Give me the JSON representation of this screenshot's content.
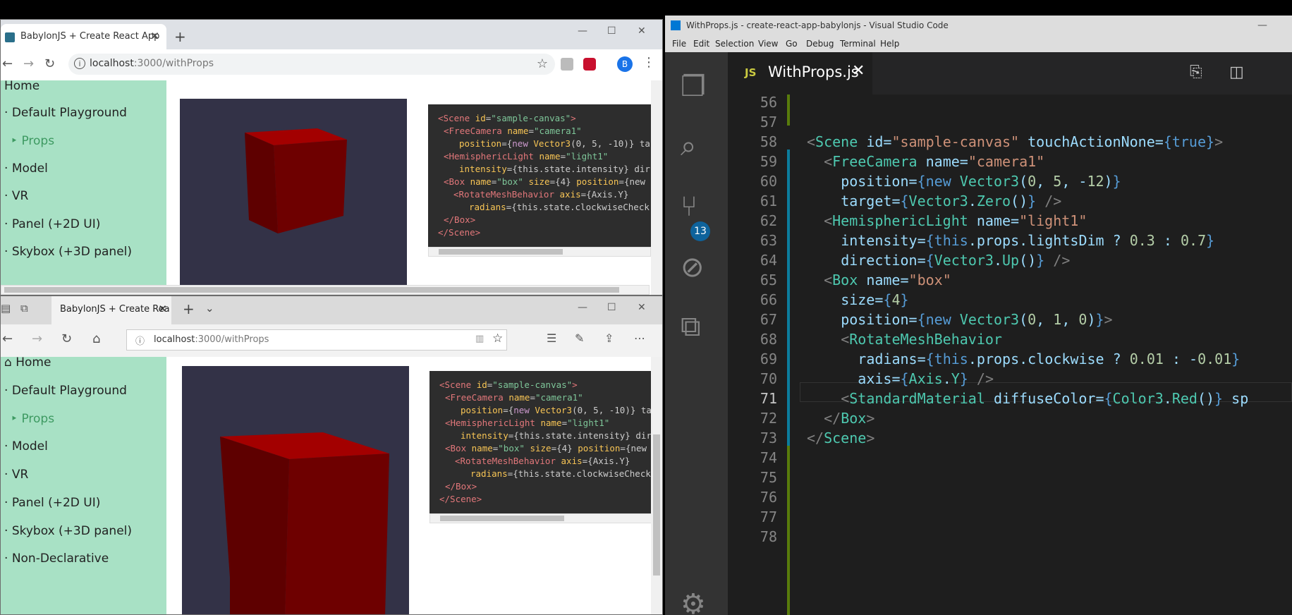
{
  "chrome": {
    "tab_title": "BabylonJS + Create React App",
    "url_host": "localhost",
    "url_rest": ":3000/withProps",
    "avatar_letter": "B"
  },
  "edge": {
    "tab_title": "BabylonJS + Create Rea",
    "url_host": "localhost",
    "url_rest": ":3000/withProps"
  },
  "nav_top": [
    "Home",
    "Default Playground",
    "Props",
    "Model",
    "VR",
    "Panel (+2D UI)",
    "Skybox (+3D panel)"
  ],
  "nav_bottom": [
    "Home",
    "Default Playground",
    "Props",
    "Model",
    "VR",
    "Panel (+2D UI)",
    "Skybox (+3D panel)",
    "Non-Declarative"
  ],
  "snippet": [
    " <Scene id=\"sample-canvas\">",
    "  <FreeCamera name=\"camera1\"",
    "    position={new Vector3(0, 5, -10)} ta",
    "  <HemisphericLight name=\"light1\"",
    "    intensity={this.state.intensity} dir",
    "  <Box name=\"box\" size={4} position={new",
    "    <RotateMeshBehavior axis={Axis.Y}",
    "      radians={this.state.clockwiseCheck",
    "  </Box>",
    "</Scene>"
  ],
  "vscode": {
    "title": "WithProps.js - create-react-app-babylonjs - Visual Studio Code",
    "menu": [
      "File",
      "Edit",
      "Selection",
      "View",
      "Go",
      "Debug",
      "Terminal",
      "Help"
    ],
    "tab_lang": "JS",
    "tab_name": "WithProps.js",
    "scm_badge": "13",
    "line_numbers": [
      "56",
      "57",
      "58",
      "59",
      "60",
      "61",
      "62",
      "63",
      "64",
      "65",
      "66",
      "67",
      "68",
      "69",
      "70",
      "71",
      "72",
      "73",
      "74",
      "75",
      "76",
      "77",
      "78"
    ],
    "code": [
      "",
      "",
      "<Scene id=\"sample-canvas\" touchActionNone={true}>",
      "  <FreeCamera name=\"camera1\"",
      "    position={new Vector3(0, 5, -12)}",
      "    target={Vector3.Zero()} />",
      "  <HemisphericLight name=\"light1\"",
      "    intensity={this.props.lightsDim ? 0.3 : 0.7}",
      "    direction={Vector3.Up()} />",
      "  <Box name=\"box\"",
      "    size={4}",
      "    position={new Vector3(0, 1, 0)}>",
      "    <RotateMeshBehavior",
      "      radians={this.props.clockwise ? 0.01 : -0.01}",
      "      axis={Axis.Y} />",
      "    <StandardMaterial diffuseColor={Color3.Red()} sp",
      "  </Box>",
      "</Scene>",
      "",
      "",
      "",
      "",
      ""
    ]
  },
  "colors": {
    "sidebar": "#a8e1c5",
    "active_nav": "#3e9a62",
    "canvas_bg": "#333247",
    "cube_face": "#8a0000"
  }
}
